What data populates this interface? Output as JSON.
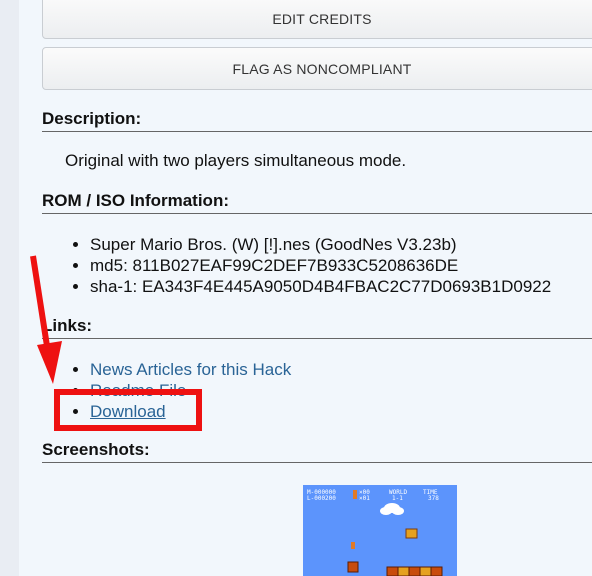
{
  "buttons": {
    "edit_credits": "EDIT CREDITS",
    "flag_noncompliant": "FLAG AS NONCOMPLIANT"
  },
  "description": {
    "heading": "Description:",
    "text": "Original with two players simultaneous mode."
  },
  "rom_info": {
    "heading": "ROM / ISO Information:",
    "items": [
      "Super Mario Bros. (W) [!].nes (GoodNes V3.23b)",
      "md5: 811B027EAF99C2DEF7B933C5208636DE",
      "sha-1: EA343F4E445A9050D4B4FBAC2C77D0693B1D0922"
    ]
  },
  "links": {
    "heading": "Links:",
    "news": "News Articles for this Hack",
    "readme": "Readme File",
    "download": "Download"
  },
  "screenshots": {
    "heading": "Screenshots:",
    "hud": {
      "score_line1": "M-000000",
      "score_line2": "L-000200",
      "coins_line1": "×00",
      "coins_line2": "×01",
      "world_label": "WORLD",
      "world_value": "1-1",
      "time_label": "TIME",
      "time_value": "378"
    }
  },
  "colors": {
    "link": "#2a6496",
    "annotation_red": "#ee1111",
    "page_bg": "#f2f7fc",
    "sky": "#5c94fc"
  }
}
